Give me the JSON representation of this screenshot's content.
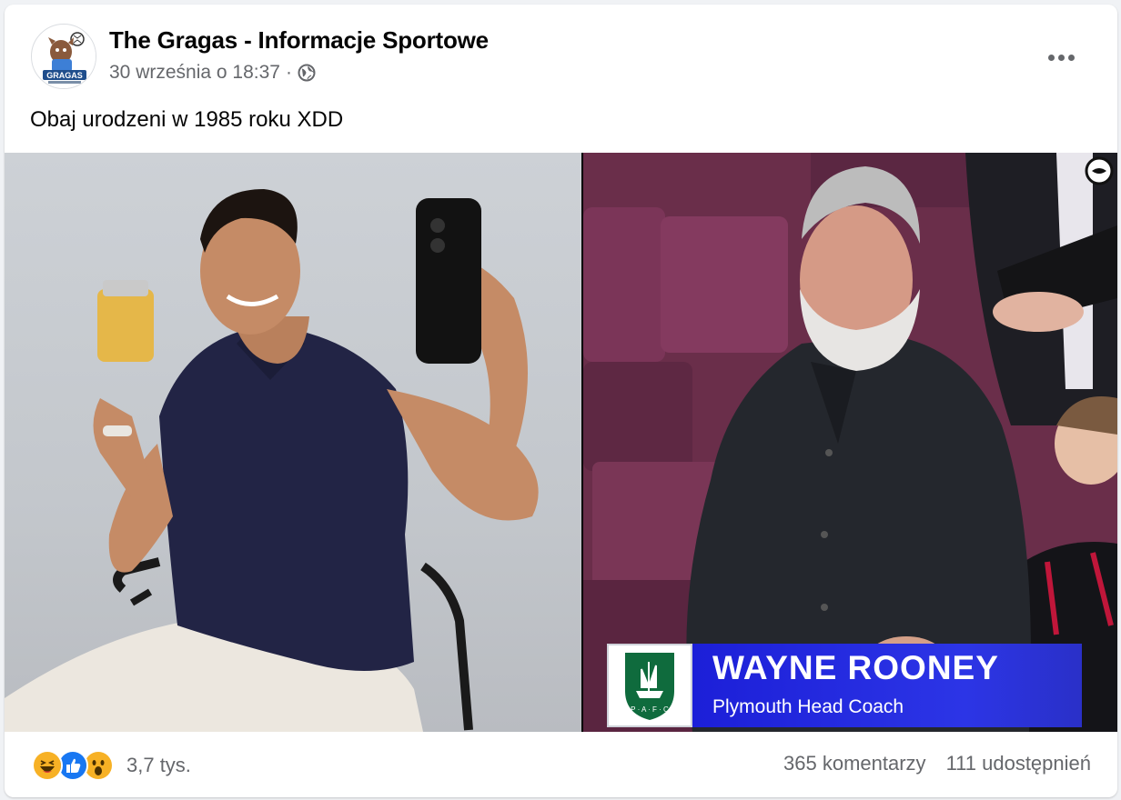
{
  "post": {
    "page_name": "The Gragas - Informacje Sportowe",
    "timestamp": "30 września o 18:37",
    "separator": "·",
    "audience_icon": "globe-icon",
    "more_icon": "more-options-icon",
    "text": "Obaj urodzeni w 1985 roku XDD",
    "avatar_logo_text": "GRAGAS"
  },
  "media": {
    "lower_third": {
      "name": "WAYNE ROONEY",
      "role": "Plymouth Head Coach",
      "crest_text": "P · A · F · C"
    },
    "colors": {
      "banner_blue": "#2c35e6",
      "crest_green": "#0f6b3d",
      "seat_purple": "#6a2e4a"
    }
  },
  "footer": {
    "reaction_icons": [
      "haha-icon",
      "like-icon",
      "wow-icon"
    ],
    "reaction_count": "3,7 tys.",
    "comments": "365 komentarzy",
    "shares": "111 udostępnień"
  },
  "colors": {
    "text_primary": "#050505",
    "text_secondary": "#65676b",
    "card_bg": "#ffffff",
    "page_bg": "#f0f2f5",
    "like_blue": "#1877f2",
    "haha_yellow": "#f7b125"
  }
}
